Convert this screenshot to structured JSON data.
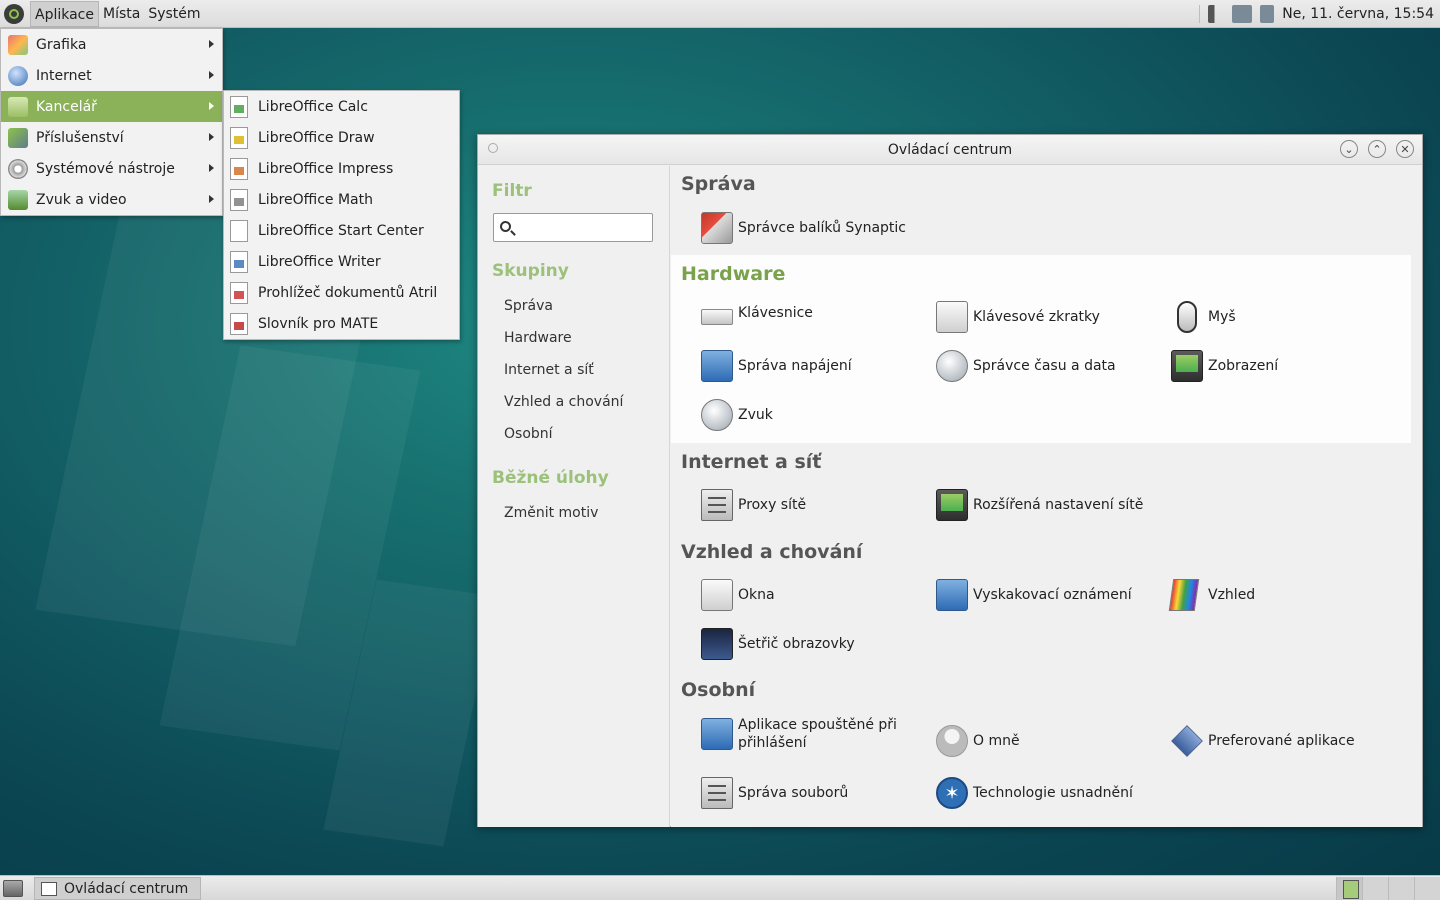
{
  "top_panel": {
    "menus": [
      "Aplikace",
      "Místa",
      "Systém"
    ],
    "clock": "Ne, 11. června, 15:54"
  },
  "app_menu": {
    "items": [
      {
        "label": "Grafika",
        "icon": "graphics-icon"
      },
      {
        "label": "Internet",
        "icon": "globe-icon"
      },
      {
        "label": "Kancelář",
        "icon": "office-icon"
      },
      {
        "label": "Příslušenství",
        "icon": "accessories-icon"
      },
      {
        "label": "Systémové nástroje",
        "icon": "system-tools-icon"
      },
      {
        "label": "Zvuk a video",
        "icon": "multimedia-icon"
      }
    ],
    "highlighted": "Kancelář"
  },
  "sub_menu": {
    "items": [
      {
        "label": "LibreOffice Calc",
        "color": "#3a9a3a"
      },
      {
        "label": "LibreOffice Draw",
        "color": "#d8b000"
      },
      {
        "label": "LibreOffice Impress",
        "color": "#d2691e"
      },
      {
        "label": "LibreOffice Math",
        "color": "#666666"
      },
      {
        "label": "LibreOffice Start Center",
        "color": "#ffffff"
      },
      {
        "label": "LibreOffice Writer",
        "color": "#2f6fb6"
      },
      {
        "label": "Prohlížeč dokumentů Atril",
        "color": "#c62828"
      },
      {
        "label": "Slovník pro MATE",
        "color": "#b71c1c"
      }
    ]
  },
  "window": {
    "title": "Ovládací centrum",
    "sidebar": {
      "filter_heading": "Filtr",
      "groups_heading": "Skupiny",
      "groups": [
        "Správa",
        "Hardware",
        "Internet a síť",
        "Vzhled a chování",
        "Osobní"
      ],
      "tasks_heading": "Běžné úlohy",
      "tasks": [
        "Změnit motiv"
      ]
    },
    "sections": {
      "sprava": {
        "title": "Správa",
        "items": [
          "Správce balíků Synaptic"
        ]
      },
      "hardware": {
        "title": "Hardware",
        "items": [
          "Klávesnice",
          "Klávesové zkratky",
          "Myš",
          "Správa napájení",
          "Správce času a data",
          "Zobrazení",
          "Zvuk"
        ]
      },
      "internet": {
        "title": "Internet a síť",
        "items": [
          "Proxy sítě",
          "Rozšířená nastavení sítě"
        ]
      },
      "vzhled": {
        "title": "Vzhled a chování",
        "items": [
          "Okna",
          "Vyskakovací oznámení",
          "Vzhled",
          "Šetřič obrazovky"
        ]
      },
      "osobni": {
        "title": "Osobní",
        "items": [
          "Aplikace spouštěné při přihlášení",
          "O mně",
          "Preferované aplikace",
          "Správa souborů",
          "Technologie usnadnění"
        ]
      }
    }
  },
  "bottom_panel": {
    "task": "Ovládací centrum"
  }
}
